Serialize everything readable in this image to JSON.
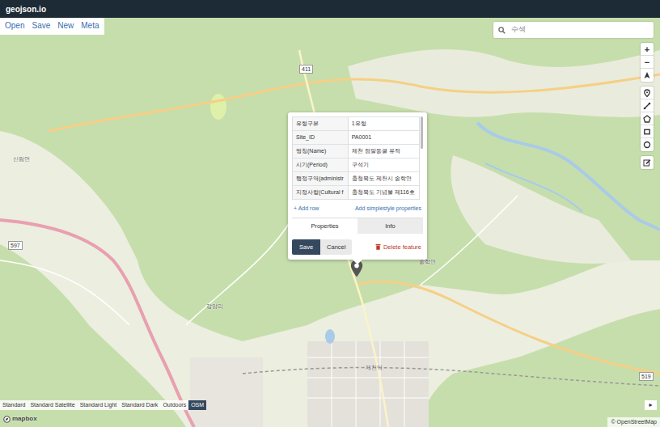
{
  "app": {
    "title": "geojson.io"
  },
  "menu": [
    {
      "label": "Open"
    },
    {
      "label": "Save"
    },
    {
      "label": "New"
    },
    {
      "label": "Meta"
    }
  ],
  "search": {
    "placeholder": "수색"
  },
  "zoom": {
    "in": "+",
    "out": "−"
  },
  "popup": {
    "properties": [
      {
        "key": "유형구분",
        "value": "1유형"
      },
      {
        "key": "Site_ID",
        "value": "PA0001"
      },
      {
        "key": "명칭(Name)",
        "value": "제천 점말동굴 유적"
      },
      {
        "key": "시기(Period)",
        "value": "구석기"
      },
      {
        "key": "행정구역(administr",
        "value": "충청북도 제천시 송학면"
      },
      {
        "key": "지정사항(Cultural f",
        "value": "충청북도 기념물 제116호"
      }
    ],
    "add_row": "+ Add row",
    "add_simplestyle": "Add simplestyle properties",
    "tabs": [
      {
        "label": "Properties",
        "selected": true
      },
      {
        "label": "Info",
        "selected": false
      }
    ],
    "save": "Save",
    "cancel": "Cancel",
    "delete": "Delete feature"
  },
  "map_labels": [
    {
      "text": "신림면",
      "kind": "place"
    },
    {
      "text": "송학면",
      "kind": "place"
    },
    {
      "text": "제천역",
      "kind": "place"
    },
    {
      "text": "강암리",
      "kind": "place"
    },
    {
      "text": "411",
      "kind": "road"
    },
    {
      "text": "597",
      "kind": "road"
    },
    {
      "text": "519",
      "kind": "road"
    }
  ],
  "styles": [
    {
      "label": "Standard",
      "selected": false
    },
    {
      "label": "Standard Satellite",
      "selected": false
    },
    {
      "label": "Standard Light",
      "selected": false
    },
    {
      "label": "Standard Dark",
      "selected": false
    },
    {
      "label": "Outdoors",
      "selected": false
    },
    {
      "label": "OSM",
      "selected": true
    }
  ],
  "collapse": "▸",
  "attribution": {
    "logo": "mapbox",
    "credit": "© OpenStreetMap"
  }
}
